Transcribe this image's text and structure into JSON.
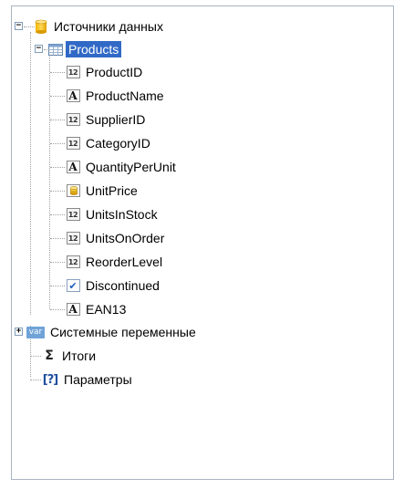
{
  "tree": {
    "root_label": "Источники данных",
    "products": {
      "label": "Products",
      "fields": [
        {
          "name": "ProductID",
          "type": "int"
        },
        {
          "name": "ProductName",
          "type": "string"
        },
        {
          "name": "SupplierID",
          "type": "int"
        },
        {
          "name": "CategoryID",
          "type": "int"
        },
        {
          "name": "QuantityPerUnit",
          "type": "string"
        },
        {
          "name": "UnitPrice",
          "type": "money"
        },
        {
          "name": "UnitsInStock",
          "type": "int"
        },
        {
          "name": "UnitsOnOrder",
          "type": "int"
        },
        {
          "name": "ReorderLevel",
          "type": "int"
        },
        {
          "name": "Discontinued",
          "type": "bool"
        },
        {
          "name": "EAN13",
          "type": "string"
        }
      ]
    },
    "system_vars_label": "Системные переменные",
    "totals_label": "Итоги",
    "params_label": "Параметры",
    "icon_texts": {
      "int": "12",
      "string": "A",
      "bool": "✔",
      "var": "var",
      "sum": "Σ",
      "param": "[?]"
    }
  }
}
